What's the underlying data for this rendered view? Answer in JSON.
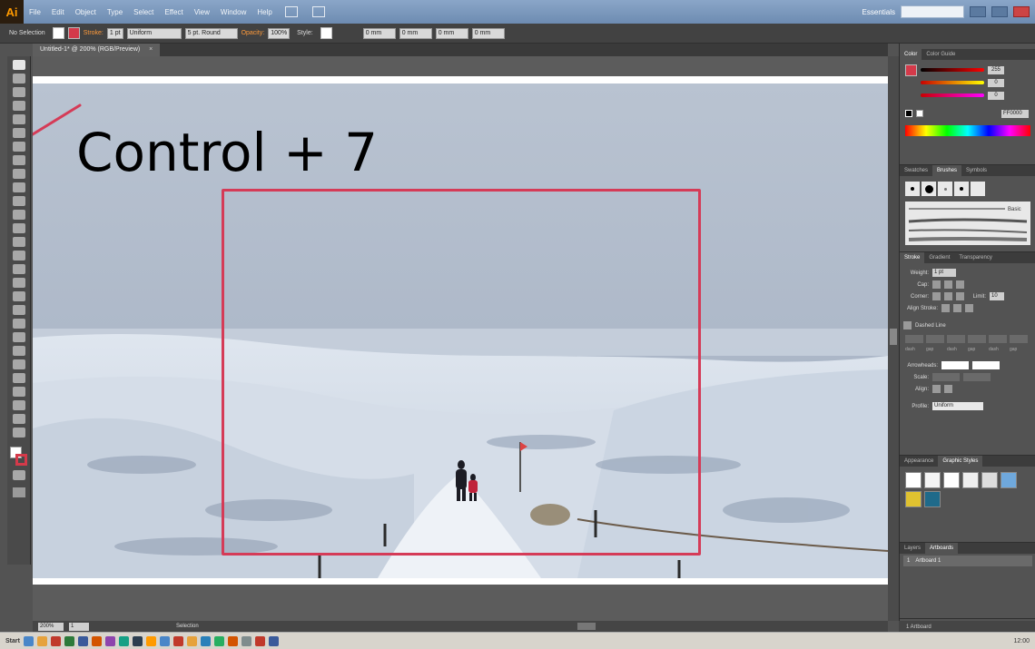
{
  "app": {
    "logo": "Ai",
    "title": "Adobe Illustrator"
  },
  "menu": [
    "File",
    "Edit",
    "Object",
    "Type",
    "Select",
    "Effect",
    "View",
    "Window",
    "Help"
  ],
  "menubar_right": {
    "workspace": "Essentials",
    "search_placeholder": ""
  },
  "control_bar": {
    "mode": "No Selection",
    "stroke_label": "Stroke:",
    "stroke_weight": "1 pt",
    "stroke_type": "Uniform",
    "brush": "5 pt. Round",
    "opacity_label": "Opacity:",
    "opacity": "100%",
    "style_label": "Style:",
    "x_value": "0 mm",
    "y_value": "0 mm",
    "w_value": "0 mm",
    "h_value": "0 mm"
  },
  "document_tab": {
    "name": "Untitled-1* @ 200% (RGB/Preview)",
    "close": "×"
  },
  "overlay_text": "Control + 7",
  "status_bar": {
    "zoom": "200%",
    "artboard_nav": "1",
    "tool_status": "Selection"
  },
  "panels": {
    "color": {
      "tabs": [
        "Color",
        "Color Guide"
      ],
      "values": [
        "255",
        "0",
        "0"
      ],
      "hex": "FF0000"
    },
    "brushes": {
      "tabs": [
        "Swatches",
        "Brushes",
        "Symbols"
      ],
      "basic": "Basic"
    },
    "stroke": {
      "tabs": [
        "Stroke",
        "Gradient",
        "Transparency"
      ],
      "weight_label": "Weight:",
      "weight": "1 pt",
      "cap_label": "Cap:",
      "corner_label": "Corner:",
      "limit_label": "Limit:",
      "limit": "10",
      "align_label": "Align Stroke:",
      "dashed_label": "Dashed Line",
      "dash_labels": [
        "dash",
        "gap",
        "dash",
        "gap",
        "dash",
        "gap"
      ],
      "arrowheads_label": "Arrowheads:",
      "scale_label": "Scale:",
      "align_arrows_label": "Align:",
      "profile_label": "Profile:",
      "profile": "Uniform"
    },
    "graphic_styles": {
      "tabs": [
        "Appearance",
        "Graphic Styles"
      ]
    },
    "artboards": {
      "tabs": [
        "Layers",
        "Artboards"
      ],
      "rows": [
        {
          "index": "1",
          "name": "Artboard 1"
        }
      ],
      "footer": "1 Artboard"
    }
  },
  "taskbar": {
    "start": "Start",
    "clock": "12:00"
  },
  "colors": {
    "accent": "#d53b57",
    "menubar": "#7b98bd",
    "panel_bg": "#535353"
  }
}
